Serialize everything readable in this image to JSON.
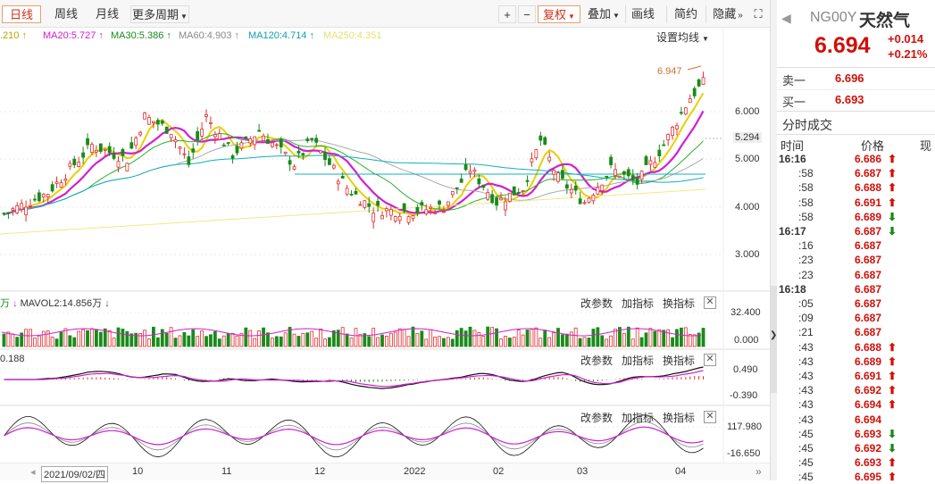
{
  "toolbar": {
    "periods": [
      "日线",
      "周线",
      "月线"
    ],
    "more_periods": "更多周期",
    "zoom_in": "+",
    "zoom_out": "−",
    "adjust": "复权",
    "overlay": "叠加",
    "draw": "画线",
    "simple": "简约",
    "hide": "隐藏"
  },
  "ma_legend": {
    "ma5": ".210",
    "ma20": "MA20:5.727",
    "ma30": "MA30:5.386",
    "ma60": "MA60:4.903",
    "ma120": "MA120:4.714",
    "ma250": "MA250:4.351",
    "settings": "设置均线"
  },
  "main_chart": {
    "y_ticks": [
      "6.000",
      "5.000",
      "4.000",
      "3.000"
    ],
    "current_price_label": "5.294",
    "max_label": "6.947"
  },
  "volume_panel": {
    "legend": "MAVOL2:14.856万",
    "y_top": "32.400",
    "y_bottom": "0.000",
    "btn_change": "改参数",
    "btn_add": "加指标",
    "btn_swap": "换指标"
  },
  "macd_panel": {
    "legend": "0.188",
    "y_top": "0.490",
    "y_bottom": "-0.390",
    "btn_change": "改参数",
    "btn_add": "加指标",
    "btn_swap": "换指标"
  },
  "kdj_panel": {
    "y_top": "117.980",
    "y_bottom": "-16.650",
    "btn_change": "改参数",
    "btn_add": "加指标",
    "btn_swap": "换指标"
  },
  "x_axis": {
    "cursor_date": "2021/09/02/四",
    "labels": [
      "10",
      "11",
      "12",
      "2022",
      "02",
      "03",
      "04"
    ]
  },
  "quote": {
    "symbol": "NG00Y",
    "name": "天然气",
    "price": "6.694",
    "change": "+0.014",
    "change_pct": "+0.21%",
    "sell_label": "卖一",
    "sell_price": "6.696",
    "buy_label": "买一",
    "buy_price": "6.693",
    "ticks_title": "分时成交",
    "col_time": "时间",
    "col_price": "价格",
    "col_vol": "现"
  },
  "trades": [
    {
      "time": "16:16",
      "price": "6.686",
      "dir": "up"
    },
    {
      "time": ":58",
      "price": "6.687",
      "dir": "up"
    },
    {
      "time": ":58",
      "price": "6.688",
      "dir": "up"
    },
    {
      "time": ":58",
      "price": "6.691",
      "dir": "up"
    },
    {
      "time": ":58",
      "price": "6.689",
      "dir": "down"
    },
    {
      "time": "16:17",
      "price": "6.687",
      "dir": "down"
    },
    {
      "time": ":16",
      "price": "6.687",
      "dir": ""
    },
    {
      "time": ":23",
      "price": "6.687",
      "dir": ""
    },
    {
      "time": ":23",
      "price": "6.687",
      "dir": ""
    },
    {
      "time": "16:18",
      "price": "6.687",
      "dir": ""
    },
    {
      "time": ":05",
      "price": "6.687",
      "dir": ""
    },
    {
      "time": ":09",
      "price": "6.687",
      "dir": ""
    },
    {
      "time": ":21",
      "price": "6.687",
      "dir": ""
    },
    {
      "time": ":43",
      "price": "6.688",
      "dir": "up"
    },
    {
      "time": ":43",
      "price": "6.689",
      "dir": "up"
    },
    {
      "time": ":43",
      "price": "6.691",
      "dir": "up"
    },
    {
      "time": ":43",
      "price": "6.692",
      "dir": "up"
    },
    {
      "time": ":43",
      "price": "6.694",
      "dir": "up"
    },
    {
      "time": ":43",
      "price": "6.694",
      "dir": ""
    },
    {
      "time": ":45",
      "price": "6.693",
      "dir": "down"
    },
    {
      "time": ":45",
      "price": "6.692",
      "dir": "down"
    },
    {
      "time": ":45",
      "price": "6.693",
      "dir": "up"
    },
    {
      "time": ":45",
      "price": "6.695",
      "dir": "up"
    }
  ]
}
